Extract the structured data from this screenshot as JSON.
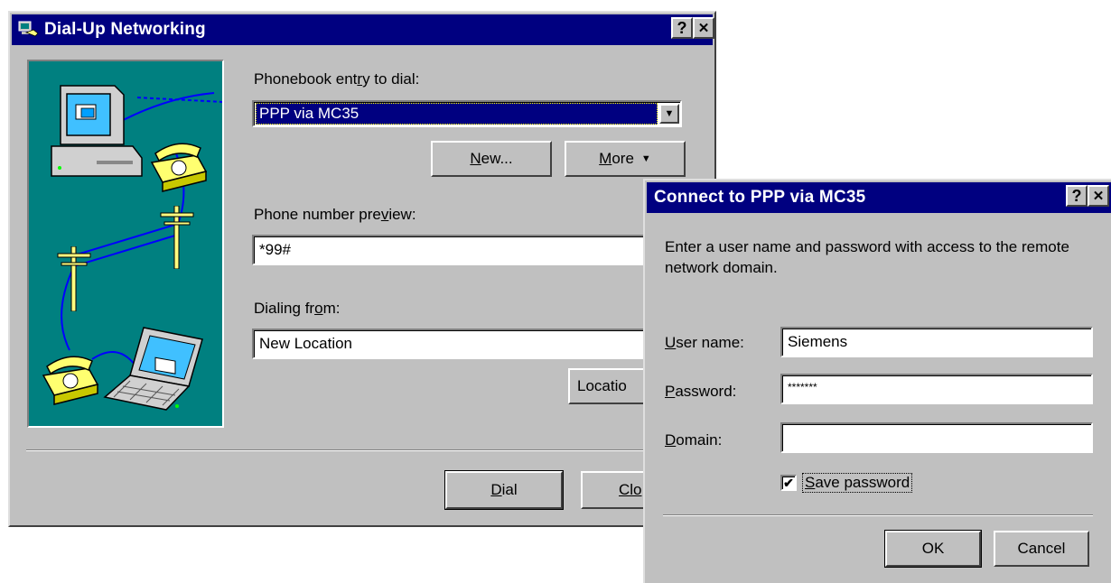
{
  "dialup": {
    "title": "Dial-Up Networking",
    "help_glyph": "?",
    "close_glyph": "✕",
    "phonebook_label_pre": "Phonebook ent",
    "phonebook_label_u": "r",
    "phonebook_label_post": "y to dial:",
    "phonebook_value": "PPP via MC35",
    "dropdown_glyph": "▼",
    "new_u": "N",
    "new_rest": "ew...",
    "more_u": "M",
    "more_rest": "ore",
    "more_arrow": "▼",
    "preview_label_pre": "Phone number pre",
    "preview_label_u": "v",
    "preview_label_post": "iew:",
    "preview_value": "*99#",
    "dialing_label_pre": "Dialing fr",
    "dialing_label_u": "o",
    "dialing_label_post": "m:",
    "dialing_value": "New Location",
    "location_label": "Locatio",
    "dial_u": "D",
    "dial_rest": "ial",
    "close_label": "Clo"
  },
  "connect": {
    "title": "Connect to PPP via MC35",
    "help_glyph": "?",
    "close_glyph": "✕",
    "message": "Enter a user name and password with access to the remote network domain.",
    "user_u": "U",
    "user_rest": "ser name:",
    "user_value": "Siemens",
    "password_u": "P",
    "password_rest": "assword:",
    "password_value": "*******",
    "domain_u": "D",
    "domain_rest": "omain:",
    "domain_value": "",
    "save_check": "✔",
    "save_u": "S",
    "save_rest": "ave password",
    "save_checked": true,
    "ok_label": "OK",
    "cancel_label": "Cancel"
  },
  "colors": {
    "titlebar": "#000080",
    "dialog_face": "#c0c0c0",
    "illustration_bg": "#008080"
  },
  "icons": [
    "dialup-networking-icon",
    "computer-icon",
    "telephone-icon",
    "telephone-pole-icon",
    "laptop-icon"
  ]
}
